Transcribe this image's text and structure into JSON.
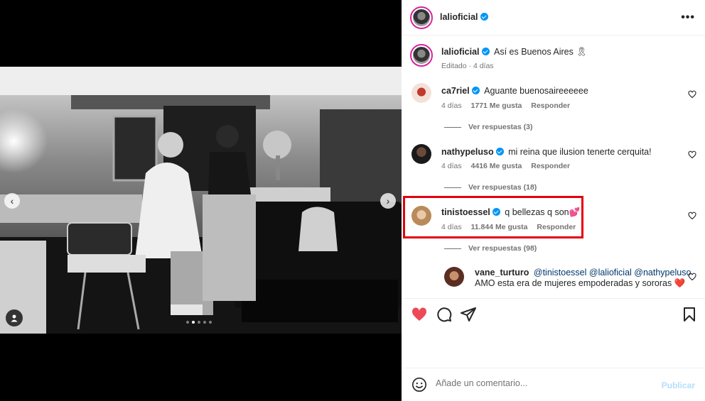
{
  "post": {
    "author": "lalioficial",
    "author_verified": true
  },
  "caption": {
    "username": "lalioficial",
    "text": "Así es Buenos Aires 🎗",
    "meta": "Editado · 4 días"
  },
  "comments": [
    {
      "username": "ca7riel",
      "verified": true,
      "text": "Aguante buenosaireeeeee",
      "time": "4 días",
      "likes": "1771 Me gusta",
      "reply": "Responder",
      "view_replies": "Ver respuestas (3)"
    },
    {
      "username": "nathypeluso",
      "verified": true,
      "text": "mi reina que ilusion tenerte cerquita!",
      "time": "4 días",
      "likes": "4416 Me gusta",
      "reply": "Responder",
      "view_replies": "Ver respuestas (18)"
    },
    {
      "username": "tinistoessel",
      "verified": true,
      "text": "q bellezas q son💕",
      "time": "4 días",
      "likes": "11.844 Me gusta",
      "reply": "Responder",
      "view_replies": "Ver respuestas (98)",
      "highlighted": true
    }
  ],
  "reply": {
    "username": "vane_turturo",
    "mentions": "@tinistoessel @lalioficial @nathypeluso",
    "text": "AMO esta era de mujeres empoderadas y sororas ❤️"
  },
  "comment_box": {
    "placeholder": "Añade un comentario...",
    "publish_label": "Publicar"
  },
  "icons": {
    "like": "heart-icon",
    "comment": "comment-icon",
    "share": "share-icon",
    "save": "bookmark-icon",
    "emoji": "emoji-icon",
    "more": "more-options-icon"
  },
  "colors": {
    "like_active": "#ed4956",
    "verified": "#0095f6",
    "highlight": "#e3000f",
    "publish_disabled": "#b2dffc"
  },
  "carousel": {
    "slides": 5,
    "active_index": 1
  }
}
